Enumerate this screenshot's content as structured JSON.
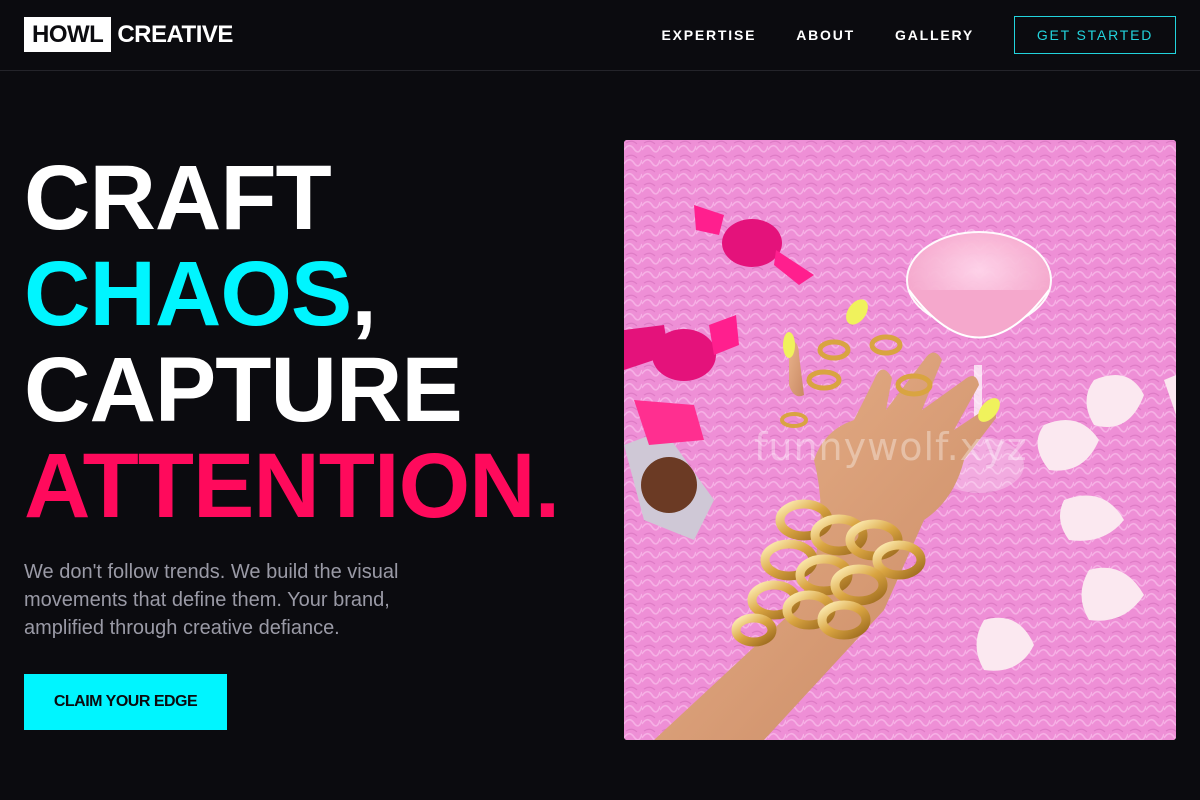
{
  "brand": {
    "logo_box": "HOWL",
    "logo_text": "CREATIVE"
  },
  "nav": {
    "links": [
      "EXPERTISE",
      "ABOUT",
      "GALLERY"
    ],
    "cta_label": "GET STARTED"
  },
  "hero": {
    "line1": "CRAFT",
    "line2_word": "CHAOS",
    "line2_punct": ",",
    "line3": "CAPTURE",
    "line4": "ATTENTION.",
    "subcopy": "We don't follow trends. We build the visual movements that define them. Your brand, amplified through creative defiance.",
    "cta_label": "CLAIM YOUR EDGE",
    "image_watermark": "funnywolf.xyz"
  },
  "colors": {
    "background": "#0b0b0f",
    "accent_cyan": "#00f5ff",
    "accent_pink": "#ff0a5c",
    "outline_cyan": "#22d3dc",
    "muted_text": "#9a9aa6"
  },
  "icons": {
    "hero_image": "hand-with-gold-jewelry-cocktail-candies-photo"
  }
}
